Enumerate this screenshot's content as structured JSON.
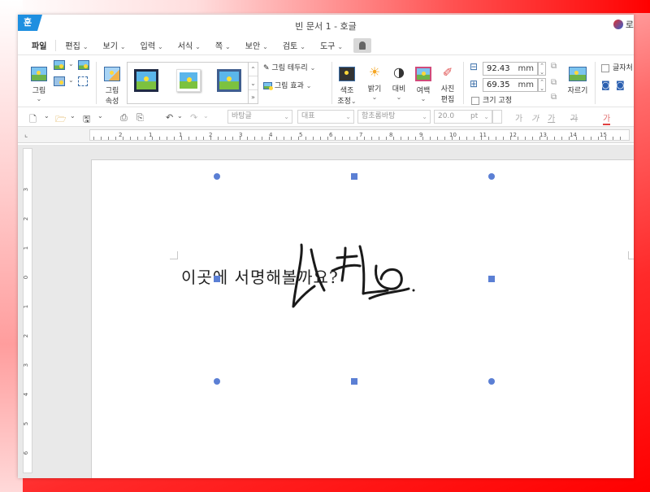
{
  "window": {
    "app_logo": "훈",
    "title": "빈 문서 1 - 호글",
    "login_label": "로"
  },
  "menu": {
    "items": [
      "파일",
      "편집",
      "보기",
      "입력",
      "서식",
      "쪽",
      "보안",
      "검토",
      "도구"
    ]
  },
  "ribbon": {
    "picture_label": "그림",
    "picture_props_label_1": "그림",
    "picture_props_label_2": "속성",
    "border_label": "그림 테두리",
    "effect_label": "그림 효과",
    "color_adjust_1": "색조",
    "color_adjust_2": "조정",
    "brightness_label": "밝기",
    "contrast_label": "대비",
    "margin_label": "여백",
    "photo_edit_1": "사진",
    "photo_edit_2": "편집",
    "width_value": "92.43",
    "height_value": "69.35",
    "unit": "mm",
    "fixed_size_label": "크기 고정",
    "crop_label": "자르기",
    "wrap_label": "글자처"
  },
  "toolbar": {
    "style_value": "바탕글",
    "lang_value": "대표",
    "font_value": "함초롬바탕",
    "size_value": "20.0",
    "size_unit": "pt",
    "fmt_buttons": [
      "가",
      "가",
      "가",
      "가",
      "가"
    ]
  },
  "ruler": {
    "h_numbers": [
      "2",
      "1",
      "1",
      "2",
      "3",
      "4",
      "5",
      "6",
      "7",
      "8",
      "9",
      "10",
      "11",
      "12",
      "13",
      "14",
      "15"
    ],
    "v_numbers": [
      "3",
      "2",
      "1",
      "0",
      "1",
      "2",
      "3",
      "4",
      "5",
      "6",
      "7"
    ]
  },
  "document": {
    "body_text": "이곳에  서명해볼까요?"
  },
  "colors": {
    "brand_blue": "#1e8fe0",
    "handle_blue": "#5b7fd4",
    "background_red": "#ff0000"
  }
}
